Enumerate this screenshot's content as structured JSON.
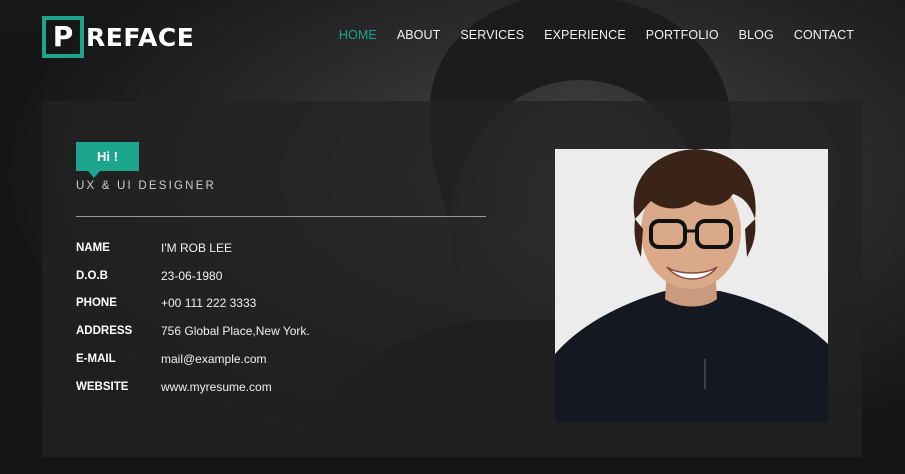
{
  "brand": {
    "logo_letter": "P",
    "logo_rest": "REFACE",
    "accent_color": "#1ba58c"
  },
  "nav": {
    "items": [
      {
        "label": "HOME",
        "active": true
      },
      {
        "label": "ABOUT",
        "active": false
      },
      {
        "label": "SERVICES",
        "active": false
      },
      {
        "label": "EXPERIENCE",
        "active": false
      },
      {
        "label": "PORTFOLIO",
        "active": false
      },
      {
        "label": "BLOG",
        "active": false
      },
      {
        "label": "CONTACT",
        "active": false
      }
    ]
  },
  "profile": {
    "greeting": "Hi !",
    "role": "UX & UI DESIGNER",
    "fields": [
      {
        "label": "NAME",
        "value": "I'M ROB LEE"
      },
      {
        "label": "D.O.B",
        "value": "23-06-1980"
      },
      {
        "label": "PHONE",
        "value": "+00 111 222 3333"
      },
      {
        "label": "ADDRESS",
        "value": "756 Global Place,New York."
      },
      {
        "label": "E-MAIL",
        "value": "mail@example.com"
      },
      {
        "label": "WEBSITE",
        "value": "www.myresume.com"
      }
    ],
    "photo_icon": "person-portrait-icon"
  }
}
